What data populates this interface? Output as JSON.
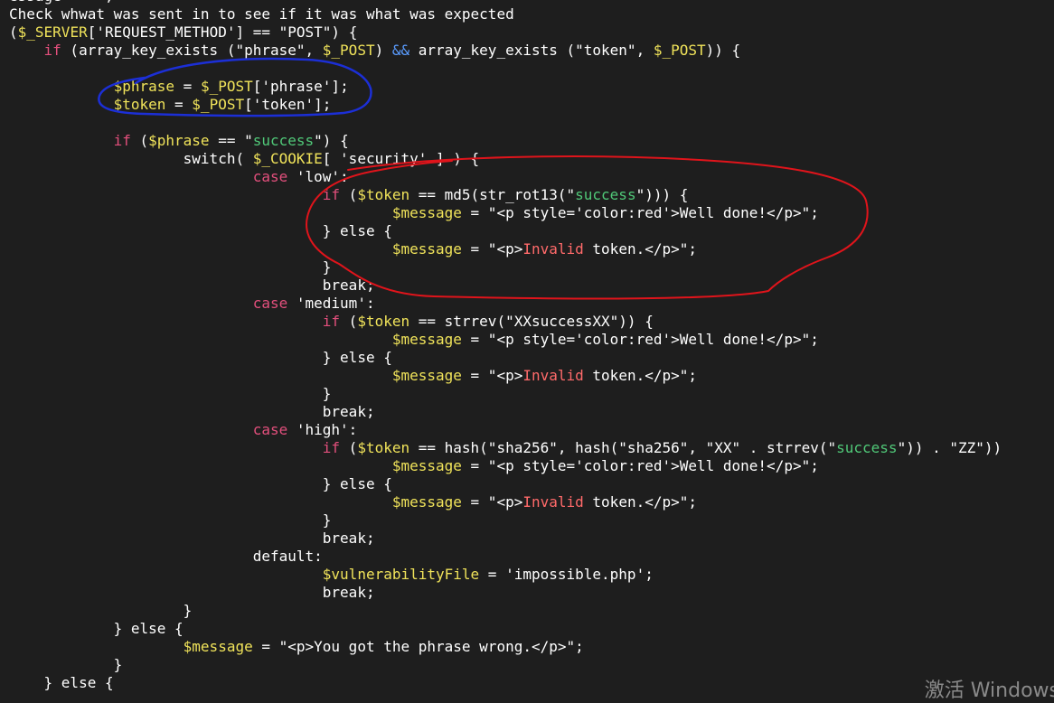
{
  "editor": {
    "lines": [
      [
        {
          "t": "essage = '';",
          "c": "default"
        }
      ],
      [
        {
          "t": "Check whwat was sent in to see if it was what was expected",
          "c": "default"
        }
      ],
      [
        {
          "t": "(",
          "c": "default"
        },
        {
          "t": "$_SERVER",
          "c": "var"
        },
        {
          "t": "['REQUEST_METHOD'] == \"POST\") {",
          "c": "default"
        }
      ],
      [
        {
          "t": "    ",
          "c": "default"
        },
        {
          "t": "if",
          "c": "kw"
        },
        {
          "t": " (array_key_exists (\"phrase\", ",
          "c": "default"
        },
        {
          "t": "$_POST",
          "c": "var"
        },
        {
          "t": ") ",
          "c": "default"
        },
        {
          "t": "&&",
          "c": "blue"
        },
        {
          "t": " array_key_exists (\"token\", ",
          "c": "default"
        },
        {
          "t": "$_POST",
          "c": "var"
        },
        {
          "t": ")) {",
          "c": "default"
        }
      ],
      [
        {
          "t": "",
          "c": "default"
        }
      ],
      [
        {
          "t": "            ",
          "c": "default"
        },
        {
          "t": "$phrase",
          "c": "var"
        },
        {
          "t": " = ",
          "c": "default"
        },
        {
          "t": "$_POST",
          "c": "var"
        },
        {
          "t": "['phrase'];",
          "c": "default"
        }
      ],
      [
        {
          "t": "            ",
          "c": "default"
        },
        {
          "t": "$token",
          "c": "var"
        },
        {
          "t": " = ",
          "c": "default"
        },
        {
          "t": "$_POST",
          "c": "var"
        },
        {
          "t": "['token'];",
          "c": "default"
        }
      ],
      [
        {
          "t": "",
          "c": "default"
        }
      ],
      [
        {
          "t": "            ",
          "c": "default"
        },
        {
          "t": "if",
          "c": "kw"
        },
        {
          "t": " (",
          "c": "default"
        },
        {
          "t": "$phrase",
          "c": "var"
        },
        {
          "t": " == \"",
          "c": "default"
        },
        {
          "t": "success",
          "c": "green"
        },
        {
          "t": "\") {",
          "c": "default"
        }
      ],
      [
        {
          "t": "                    switch( ",
          "c": "default"
        },
        {
          "t": "$_COOKIE",
          "c": "var"
        },
        {
          "t": "[ 'security' ] ) {",
          "c": "default"
        }
      ],
      [
        {
          "t": "                            ",
          "c": "default"
        },
        {
          "t": "case",
          "c": "kw"
        },
        {
          "t": " 'low':",
          "c": "default"
        }
      ],
      [
        {
          "t": "                                    ",
          "c": "default"
        },
        {
          "t": "if",
          "c": "kw"
        },
        {
          "t": " (",
          "c": "default"
        },
        {
          "t": "$token",
          "c": "var"
        },
        {
          "t": " == md5(str_rot13(\"",
          "c": "default"
        },
        {
          "t": "success",
          "c": "green"
        },
        {
          "t": "\"))) {",
          "c": "default"
        }
      ],
      [
        {
          "t": "                                            ",
          "c": "default"
        },
        {
          "t": "$message",
          "c": "var"
        },
        {
          "t": " = \"<p style='color:red'>Well done!</p>\";",
          "c": "default"
        }
      ],
      [
        {
          "t": "                                    } else {",
          "c": "default"
        }
      ],
      [
        {
          "t": "                                            ",
          "c": "default"
        },
        {
          "t": "$message",
          "c": "var"
        },
        {
          "t": " = \"<p>",
          "c": "default"
        },
        {
          "t": "Invalid",
          "c": "red"
        },
        {
          "t": " token.</p>\";",
          "c": "default"
        }
      ],
      [
        {
          "t": "                                    }",
          "c": "default"
        }
      ],
      [
        {
          "t": "                                    break;",
          "c": "default"
        }
      ],
      [
        {
          "t": "                            ",
          "c": "default"
        },
        {
          "t": "case",
          "c": "kw"
        },
        {
          "t": " 'medium':",
          "c": "default"
        }
      ],
      [
        {
          "t": "                                    ",
          "c": "default"
        },
        {
          "t": "if",
          "c": "kw"
        },
        {
          "t": " (",
          "c": "default"
        },
        {
          "t": "$token",
          "c": "var"
        },
        {
          "t": " == strrev(\"XXsuccessXX\")) {",
          "c": "default"
        }
      ],
      [
        {
          "t": "                                            ",
          "c": "default"
        },
        {
          "t": "$message",
          "c": "var"
        },
        {
          "t": " = \"<p style='color:red'>Well done!</p>\";",
          "c": "default"
        }
      ],
      [
        {
          "t": "                                    } else {",
          "c": "default"
        }
      ],
      [
        {
          "t": "                                            ",
          "c": "default"
        },
        {
          "t": "$message",
          "c": "var"
        },
        {
          "t": " = \"<p>",
          "c": "default"
        },
        {
          "t": "Invalid",
          "c": "red"
        },
        {
          "t": " token.</p>\";",
          "c": "default"
        }
      ],
      [
        {
          "t": "                                    }",
          "c": "default"
        }
      ],
      [
        {
          "t": "                                    break;",
          "c": "default"
        }
      ],
      [
        {
          "t": "                            ",
          "c": "default"
        },
        {
          "t": "case",
          "c": "kw"
        },
        {
          "t": " 'high':",
          "c": "default"
        }
      ],
      [
        {
          "t": "                                    ",
          "c": "default"
        },
        {
          "t": "if",
          "c": "kw"
        },
        {
          "t": " (",
          "c": "default"
        },
        {
          "t": "$token",
          "c": "var"
        },
        {
          "t": " == hash(\"sha256\", hash(\"sha256\", \"XX\" . strrev(\"",
          "c": "default"
        },
        {
          "t": "success",
          "c": "green"
        },
        {
          "t": "\")) . \"ZZ\"))",
          "c": "default"
        }
      ],
      [
        {
          "t": "                                            ",
          "c": "default"
        },
        {
          "t": "$message",
          "c": "var"
        },
        {
          "t": " = \"<p style='color:red'>Well done!</p>\";",
          "c": "default"
        }
      ],
      [
        {
          "t": "                                    } else {",
          "c": "default"
        }
      ],
      [
        {
          "t": "                                            ",
          "c": "default"
        },
        {
          "t": "$message",
          "c": "var"
        },
        {
          "t": " = \"<p>",
          "c": "default"
        },
        {
          "t": "Invalid",
          "c": "red"
        },
        {
          "t": " token.</p>\";",
          "c": "default"
        }
      ],
      [
        {
          "t": "                                    }",
          "c": "default"
        }
      ],
      [
        {
          "t": "                                    break;",
          "c": "default"
        }
      ],
      [
        {
          "t": "                            default:",
          "c": "default"
        }
      ],
      [
        {
          "t": "                                    ",
          "c": "default"
        },
        {
          "t": "$vulnerabilityFile",
          "c": "var"
        },
        {
          "t": " = 'impossible.php';",
          "c": "default"
        }
      ],
      [
        {
          "t": "                                    break;",
          "c": "default"
        }
      ],
      [
        {
          "t": "                    }",
          "c": "default"
        }
      ],
      [
        {
          "t": "            } else {",
          "c": "default"
        }
      ],
      [
        {
          "t": "                    ",
          "c": "default"
        },
        {
          "t": "$message",
          "c": "var"
        },
        {
          "t": " = \"<p>You got the phrase wrong.</p>\";",
          "c": "default"
        }
      ],
      [
        {
          "t": "            }",
          "c": "default"
        }
      ],
      [
        {
          "t": "    } else {",
          "c": "default"
        }
      ]
    ]
  },
  "colors": {
    "background": "#1e1e1e",
    "annotation_blue": "#1c2fd6",
    "annotation_red": "#e0141b"
  },
  "watermark": {
    "text": "激活 Windows"
  }
}
